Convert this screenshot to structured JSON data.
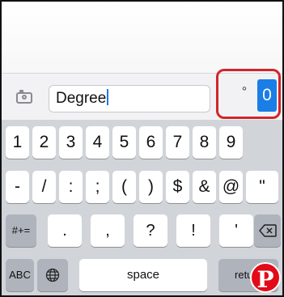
{
  "text_field": {
    "value": "Degree"
  },
  "suggestions": {
    "degree_symbol": "°",
    "zero": "0"
  },
  "keyboard": {
    "row1": [
      "1",
      "2",
      "3",
      "4",
      "5",
      "6",
      "7",
      "8",
      "9"
    ],
    "row2": [
      "-",
      "/",
      ":",
      ";",
      "(",
      ")",
      "$",
      "&",
      "@",
      "\""
    ],
    "row3": {
      "shift": "#+=",
      "keys": [
        ".",
        ",",
        "?",
        "!",
        "'"
      ]
    },
    "row4": {
      "abc": "ABC",
      "space": "space",
      "return": "return"
    }
  },
  "icons": {
    "camera": "camera-icon",
    "globe": "globe-icon",
    "delete": "backspace-icon",
    "watermark": "pinterest-logo-icon"
  },
  "colors": {
    "highlight_box": "#d0262b",
    "selected_suggestion": "#1a7ee6",
    "keyboard_bg": "#d1d4d9",
    "watermark": "#e30b17"
  }
}
